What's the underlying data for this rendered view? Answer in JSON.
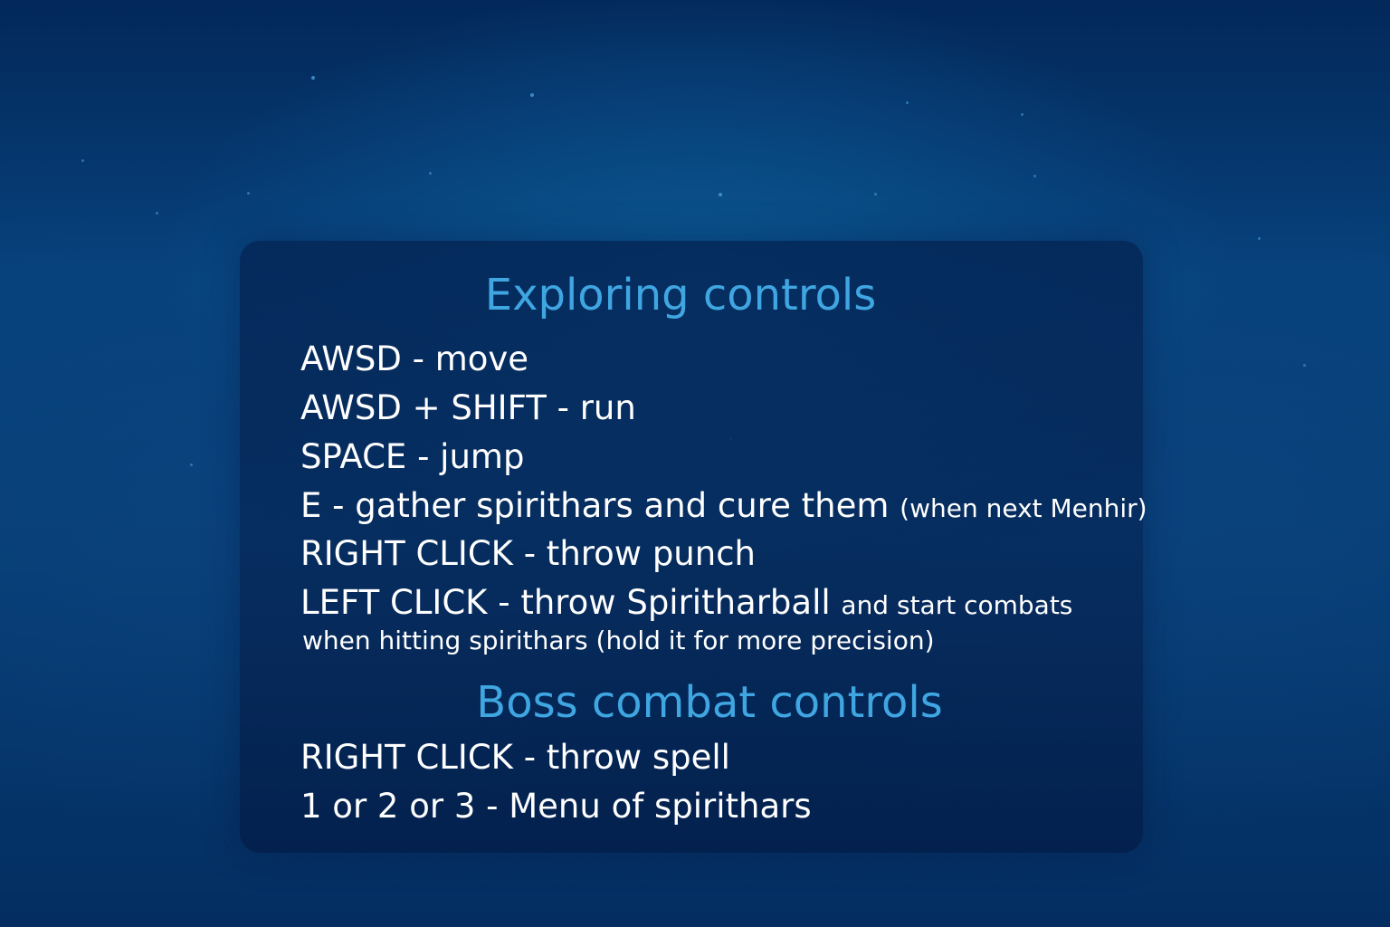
{
  "exploring": {
    "title": "Exploring controls",
    "lines": [
      {
        "text": "AWSD - move"
      },
      {
        "text": "AWSD + SHIFT - run"
      },
      {
        "text": "SPACE - jump"
      },
      {
        "text": "E - gather spirithars and cure them",
        "note": "(when next Menhir)"
      },
      {
        "text": "RIGHT CLICK - throw punch"
      },
      {
        "text": "LEFT CLICK - throw Spiritharball",
        "note": "and start combats",
        "continuation": "when hitting spirithars (hold it for more precision)"
      }
    ]
  },
  "boss": {
    "title": "Boss combat controls",
    "lines": [
      {
        "text": "RIGHT CLICK - throw spell"
      },
      {
        "text": "1 or 2 or 3 - Menu of spirithars"
      }
    ]
  },
  "colors": {
    "heading": "#3fa6e2",
    "text": "#ffffff",
    "background": "#063d74",
    "panel": "#052a5c"
  }
}
